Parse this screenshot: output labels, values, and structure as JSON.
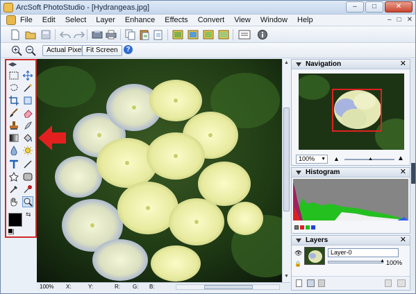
{
  "window": {
    "title": "ArcSoft PhotoStudio - [Hydrangeas.jpg]",
    "buttons": {
      "minimize": "–",
      "maximize": "□",
      "close": "✕"
    }
  },
  "menubar": {
    "items": [
      "File",
      "Edit",
      "Select",
      "Layer",
      "Enhance",
      "Effects",
      "Convert",
      "View",
      "Window",
      "Help"
    ],
    "mdi": {
      "minimize": "–",
      "restore": "□",
      "close": "✕"
    }
  },
  "toolbar2": {
    "actual_pixels": "Actual Pixels",
    "fit_screen": "Fit Screen",
    "help": "?"
  },
  "status": {
    "zoom": "100%",
    "x_label": "X:",
    "y_label": "Y:",
    "r_label": "R:",
    "g_label": "G:",
    "b_label": "B:"
  },
  "navigation": {
    "title": "Navigation",
    "zoom_value": "100%"
  },
  "histogram": {
    "title": "Histogram"
  },
  "layers": {
    "title": "Layers",
    "layer_name": "Layer-0",
    "opacity": "100%",
    "opacity_value": 100
  },
  "colors": {
    "highlight_red": "#d0292a",
    "fg_color": "#000000",
    "bg_color": "#ffffff"
  }
}
